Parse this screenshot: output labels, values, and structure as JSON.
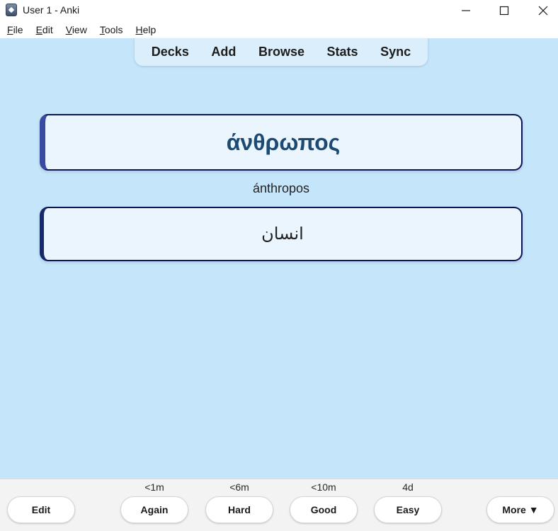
{
  "window": {
    "title": "User 1 - Anki"
  },
  "menu": [
    {
      "key": "F",
      "rest": "ile"
    },
    {
      "key": "E",
      "rest": "dit"
    },
    {
      "key": "V",
      "rest": "iew"
    },
    {
      "key": "T",
      "rest": "ools"
    },
    {
      "key": "H",
      "rest": "elp"
    }
  ],
  "toolbar": {
    "decks": "Decks",
    "add": "Add",
    "browse": "Browse",
    "stats": "Stats",
    "sync": "Sync"
  },
  "card": {
    "front": "άνθρωπος",
    "transliteration": "ánthropos",
    "back": "انسان"
  },
  "bottom": {
    "edit": "Edit",
    "more": "More ▼",
    "answers": [
      {
        "label": "Again",
        "interval": "<1m"
      },
      {
        "label": "Hard",
        "interval": "<6m"
      },
      {
        "label": "Good",
        "interval": "<10m"
      },
      {
        "label": "Easy",
        "interval": "4d"
      }
    ]
  },
  "colors": {
    "background": "#c5e5fa",
    "card_fill": "#eaf5fe",
    "card_border": "#0e1554",
    "front_text": "#1d4a72"
  },
  "icons": [
    "anki-app-icon",
    "minimize-icon",
    "maximize-icon",
    "close-icon"
  ]
}
